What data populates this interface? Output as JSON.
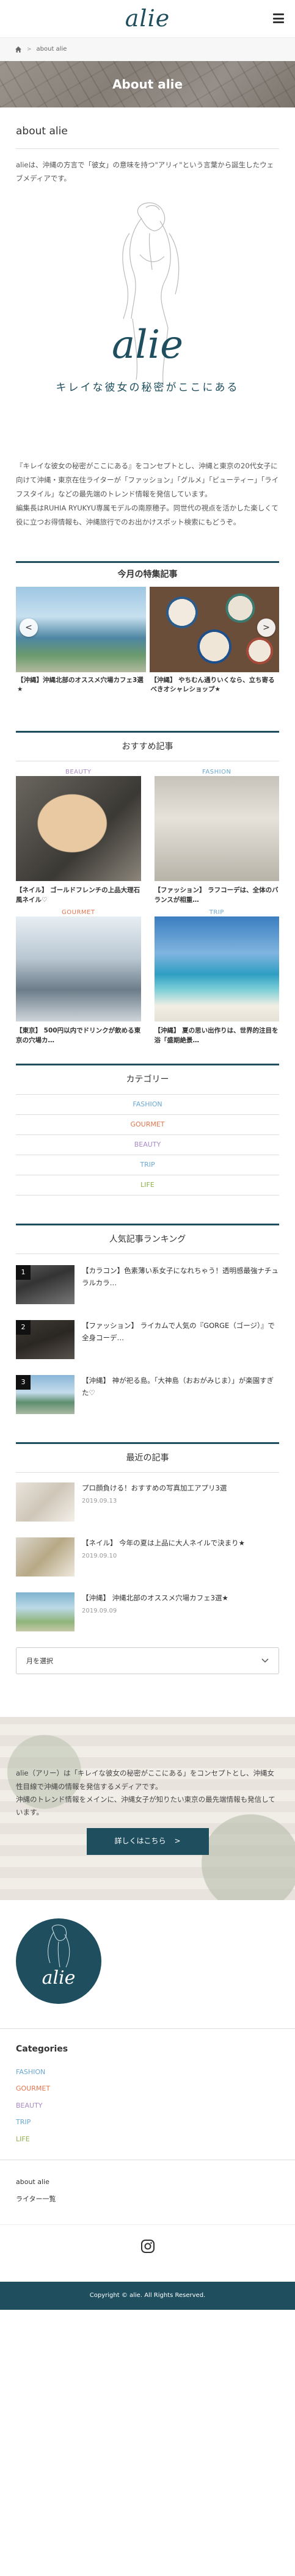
{
  "header": {
    "logo": "alie"
  },
  "breadcrumb": {
    "current": "about alie"
  },
  "hero": {
    "title": "About alie"
  },
  "page": {
    "title": "about alie",
    "intro": "alieは、沖縄の方言で「彼女」の意味を持つ\"アリィ\"という言葉から誕生したウェブメディアです。"
  },
  "brand": {
    "logo": "alie",
    "tagline": "キレイな彼女の秘密がここにある"
  },
  "about": {
    "p1": "『キレイな彼女の秘密がここにある』をコンセプトとし、沖縄と東京の20代女子に向けて沖縄・東京在住ライターが「ファッション」「グルメ」「ビューティー」「ライフスタイル」などの最先端のトレンド情報を発信しています。",
    "p2": "編集長はRUHIA RYUKYU専属モデルの南原穂子。同世代の視点を活かした楽しくて役に立つお得情報も、沖縄旅行でのお出かけスポット検索にもどうぞ。"
  },
  "featured": {
    "heading": "今月の特集記事",
    "slides": [
      {
        "caption": "【沖縄】沖縄北部のオススメ穴場カフェ3選★"
      },
      {
        "caption": "【沖縄】 やちむん通りいくなら、立ち寄るべきオシャレショップ★"
      }
    ]
  },
  "recommended": {
    "heading": "おすすめ記事",
    "cards": [
      {
        "badge": "BEAUTY",
        "badge_color": "#a98ac7",
        "text": "【ネイル】 ゴールドフレンチの上品大理石風ネイル♡"
      },
      {
        "badge": "FASHION",
        "badge_color": "#6aa8d3",
        "text": "【ファッション】 ラフコーデは、全体のバランスが相重…"
      },
      {
        "badge": "GOURMET",
        "badge_color": "#e0754f",
        "text": "【東京】 500円以内でドリンクが飲める東京の穴場カ…"
      },
      {
        "badge": "TRIP",
        "badge_color": "#6aa8d3",
        "text": "【沖縄】 夏の思い出作りは、世界的注目を浴「盛期絶景…"
      }
    ]
  },
  "categories": {
    "heading": "カテゴリー",
    "items": [
      {
        "label": "FASHION",
        "color": "#6aa8d3"
      },
      {
        "label": "GOURMET",
        "color": "#e0754f"
      },
      {
        "label": "BEAUTY",
        "color": "#a98ac7"
      },
      {
        "label": "TRIP",
        "color": "#6aa8d3"
      },
      {
        "label": "LIFE",
        "color": "#8fb04c"
      }
    ]
  },
  "ranking": {
    "heading": "人気記事ランキング",
    "items": [
      {
        "rank": "1",
        "text": "【カラコン】色素薄い系女子になれちゃう！透明感最強ナチュラルカラ…"
      },
      {
        "rank": "2",
        "text": "【ファッション】 ライカムで人気の『GORGE（ゴージ）』で全身コーデ…"
      },
      {
        "rank": "3",
        "text": "【沖縄】 神が祀る島。「大神島（おおがみじま）」が楽園すぎた♡"
      }
    ]
  },
  "recent": {
    "heading": "最近の記事",
    "items": [
      {
        "title": "プロ顔負ける！おすすめの写真加工アプリ3選",
        "date": "2019.09.13"
      },
      {
        "title": "【ネイル】 今年の夏は上品に大人ネイルで決まり★",
        "date": "2019.09.10"
      },
      {
        "title": "【沖縄】 沖縄北部のオススメ穴場カフェ3選★",
        "date": "2019.09.09"
      }
    ]
  },
  "archive": {
    "label": "月を選択"
  },
  "promo": {
    "p1": "alie（アリー）は「キレイな彼女の秘密がここにある」をコンセプトとし、沖縄女性目線で沖縄の情報を発信するメディアです。",
    "p2": "沖縄のトレンド情報をメインに、沖縄女子が知りたい東京の最先端情報も発信しています。",
    "button": "詳しくはこちら"
  },
  "footer": {
    "logo": "alie",
    "categories_title": "Categories",
    "categories": [
      {
        "label": "FASHION",
        "color": "#6aa8d3"
      },
      {
        "label": "GOURMET",
        "color": "#e0754f"
      },
      {
        "label": "BEAUTY",
        "color": "#a98ac7"
      },
      {
        "label": "TRIP",
        "color": "#6aa8d3"
      },
      {
        "label": "LIFE",
        "color": "#8fb04c"
      }
    ],
    "links": [
      "about alie",
      "ライター一覧"
    ],
    "copyright": "Copyright © alie. All Rights Reserved."
  },
  "colors": {
    "brand": "#1f4f5f"
  },
  "icons": [
    "hamburger-icon",
    "home-icon",
    "chevron-right-icon",
    "chevron-left-icon",
    "chevron-down-icon",
    "instagram-icon"
  ]
}
